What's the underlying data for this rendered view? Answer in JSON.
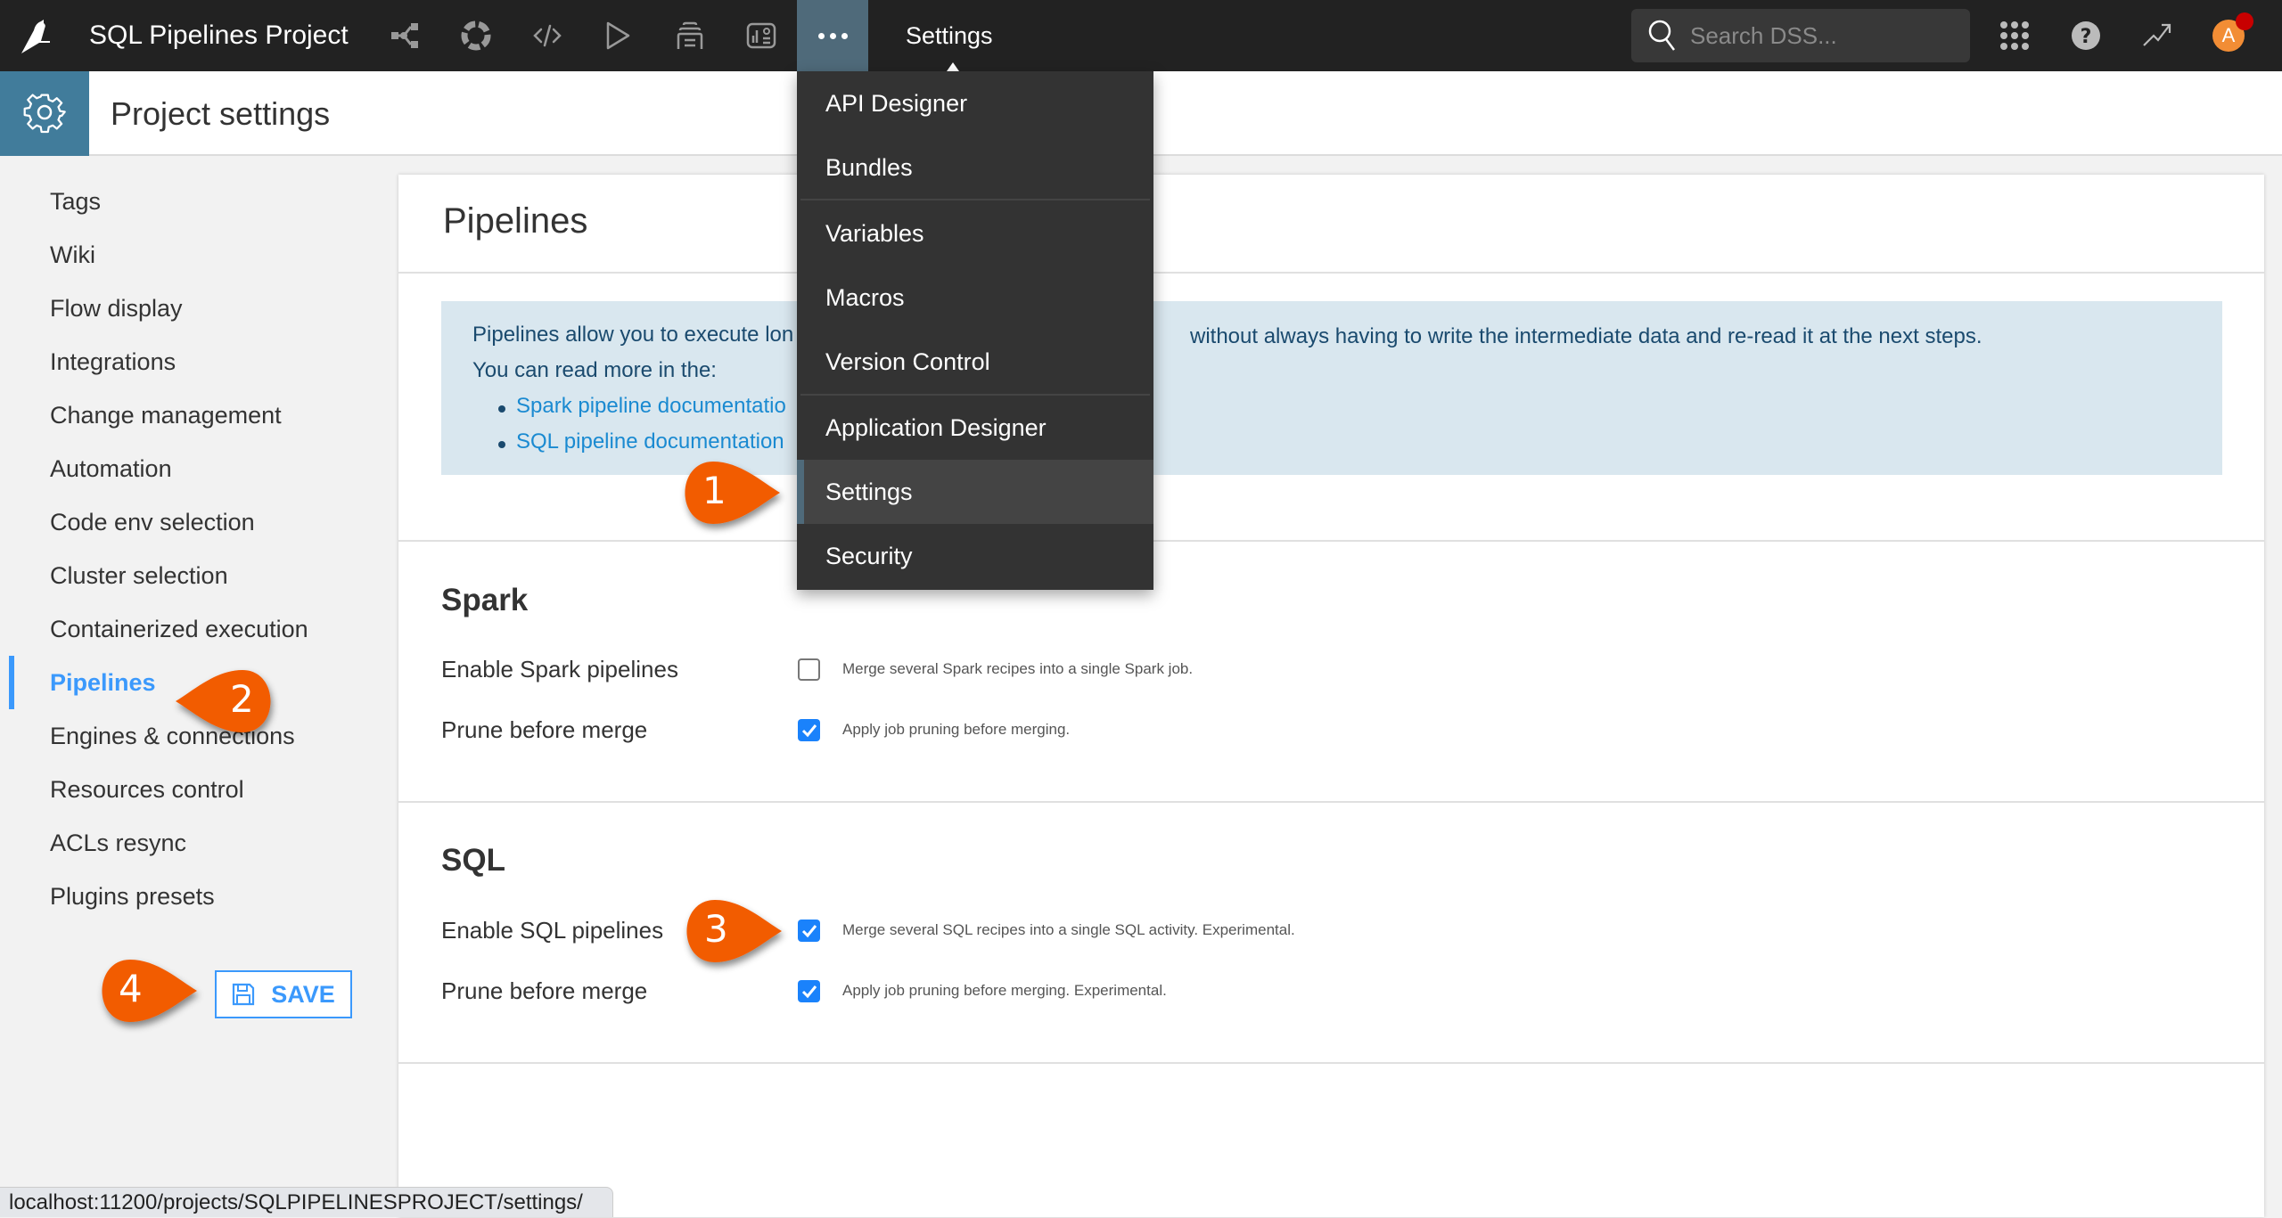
{
  "topnav": {
    "project_title": "SQL Pipelines Project",
    "current_section": "Settings",
    "search_placeholder": "Search DSS...",
    "avatar_initial": "A",
    "icons": [
      "flow-icon",
      "datasets-icon",
      "code-icon",
      "jobs-icon",
      "dashboards-icon",
      "insights-icon",
      "more-icon"
    ],
    "right_icons": [
      "apps-grid-icon",
      "help-icon",
      "trend-icon"
    ]
  },
  "subheader": {
    "title": "Project settings"
  },
  "sidebar": {
    "items": [
      {
        "label": "Tags"
      },
      {
        "label": "Wiki"
      },
      {
        "label": "Flow display"
      },
      {
        "label": "Integrations"
      },
      {
        "label": "Change management"
      },
      {
        "label": "Automation"
      },
      {
        "label": "Code env selection"
      },
      {
        "label": "Cluster selection"
      },
      {
        "label": "Containerized execution"
      },
      {
        "label": "Pipelines",
        "active": true
      },
      {
        "label": "Engines & connections"
      },
      {
        "label": "Resources control"
      },
      {
        "label": "ACLs resync"
      },
      {
        "label": "Plugins presets"
      }
    ],
    "save_label": "SAVE"
  },
  "main": {
    "title": "Pipelines",
    "info": {
      "line1_left": "Pipelines allow you to execute lon",
      "line1_right": "without always having to write the intermediate data and re-read it at the next steps.",
      "line2": "You can read more in the:",
      "links": [
        "Spark pipeline documentatio",
        "SQL pipeline documentation"
      ]
    },
    "sections": [
      {
        "title": "Spark",
        "fields": [
          {
            "label": "Enable Spark pipelines",
            "checked": false,
            "description": "Merge several Spark recipes into a single Spark job."
          },
          {
            "label": "Prune before merge",
            "checked": true,
            "description": "Apply job pruning before merging."
          }
        ]
      },
      {
        "title": "SQL",
        "fields": [
          {
            "label": "Enable SQL pipelines",
            "checked": true,
            "description": "Merge several SQL recipes into a single SQL activity. Experimental."
          },
          {
            "label": "Prune before merge",
            "checked": true,
            "description": "Apply job pruning before merging. Experimental."
          }
        ]
      }
    ]
  },
  "menu": {
    "items": [
      {
        "label": "API Designer"
      },
      {
        "label": "Bundles"
      },
      {
        "label": "Variables"
      },
      {
        "label": "Macros"
      },
      {
        "label": "Version Control"
      },
      {
        "label": "Application Designer"
      },
      {
        "label": "Settings",
        "selected": true
      },
      {
        "label": "Security"
      }
    ]
  },
  "annotations": [
    "1",
    "2",
    "3",
    "4"
  ],
  "statusbar": {
    "url": "localhost:11200/projects/SQLPIPELINESPROJECT/settings/"
  },
  "colors": {
    "accent": "#3b99fc",
    "topnav_bg": "#222222",
    "settings_tile": "#417c9b",
    "callout": "#f25c05",
    "info_bg": "#d9e7ef"
  }
}
